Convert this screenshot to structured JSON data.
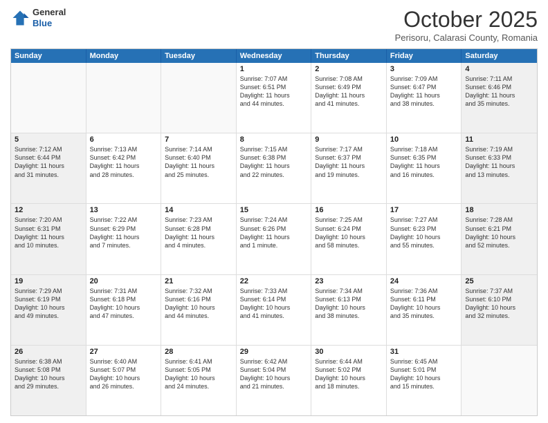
{
  "header": {
    "logo_general": "General",
    "logo_blue": "Blue",
    "month_title": "October 2025",
    "subtitle": "Perisoru, Calarasi County, Romania"
  },
  "weekdays": [
    "Sunday",
    "Monday",
    "Tuesday",
    "Wednesday",
    "Thursday",
    "Friday",
    "Saturday"
  ],
  "rows": [
    [
      {
        "day": "",
        "text": "",
        "empty": true
      },
      {
        "day": "",
        "text": "",
        "empty": true
      },
      {
        "day": "",
        "text": "",
        "empty": true
      },
      {
        "day": "1",
        "text": "Sunrise: 7:07 AM\nSunset: 6:51 PM\nDaylight: 11 hours\nand 44 minutes.",
        "empty": false
      },
      {
        "day": "2",
        "text": "Sunrise: 7:08 AM\nSunset: 6:49 PM\nDaylight: 11 hours\nand 41 minutes.",
        "empty": false
      },
      {
        "day": "3",
        "text": "Sunrise: 7:09 AM\nSunset: 6:47 PM\nDaylight: 11 hours\nand 38 minutes.",
        "empty": false
      },
      {
        "day": "4",
        "text": "Sunrise: 7:11 AM\nSunset: 6:46 PM\nDaylight: 11 hours\nand 35 minutes.",
        "empty": false,
        "shaded": true
      }
    ],
    [
      {
        "day": "5",
        "text": "Sunrise: 7:12 AM\nSunset: 6:44 PM\nDaylight: 11 hours\nand 31 minutes.",
        "empty": false,
        "shaded": true
      },
      {
        "day": "6",
        "text": "Sunrise: 7:13 AM\nSunset: 6:42 PM\nDaylight: 11 hours\nand 28 minutes.",
        "empty": false
      },
      {
        "day": "7",
        "text": "Sunrise: 7:14 AM\nSunset: 6:40 PM\nDaylight: 11 hours\nand 25 minutes.",
        "empty": false
      },
      {
        "day": "8",
        "text": "Sunrise: 7:15 AM\nSunset: 6:38 PM\nDaylight: 11 hours\nand 22 minutes.",
        "empty": false
      },
      {
        "day": "9",
        "text": "Sunrise: 7:17 AM\nSunset: 6:37 PM\nDaylight: 11 hours\nand 19 minutes.",
        "empty": false
      },
      {
        "day": "10",
        "text": "Sunrise: 7:18 AM\nSunset: 6:35 PM\nDaylight: 11 hours\nand 16 minutes.",
        "empty": false
      },
      {
        "day": "11",
        "text": "Sunrise: 7:19 AM\nSunset: 6:33 PM\nDaylight: 11 hours\nand 13 minutes.",
        "empty": false,
        "shaded": true
      }
    ],
    [
      {
        "day": "12",
        "text": "Sunrise: 7:20 AM\nSunset: 6:31 PM\nDaylight: 11 hours\nand 10 minutes.",
        "empty": false,
        "shaded": true
      },
      {
        "day": "13",
        "text": "Sunrise: 7:22 AM\nSunset: 6:29 PM\nDaylight: 11 hours\nand 7 minutes.",
        "empty": false
      },
      {
        "day": "14",
        "text": "Sunrise: 7:23 AM\nSunset: 6:28 PM\nDaylight: 11 hours\nand 4 minutes.",
        "empty": false
      },
      {
        "day": "15",
        "text": "Sunrise: 7:24 AM\nSunset: 6:26 PM\nDaylight: 11 hours\nand 1 minute.",
        "empty": false
      },
      {
        "day": "16",
        "text": "Sunrise: 7:25 AM\nSunset: 6:24 PM\nDaylight: 10 hours\nand 58 minutes.",
        "empty": false
      },
      {
        "day": "17",
        "text": "Sunrise: 7:27 AM\nSunset: 6:23 PM\nDaylight: 10 hours\nand 55 minutes.",
        "empty": false
      },
      {
        "day": "18",
        "text": "Sunrise: 7:28 AM\nSunset: 6:21 PM\nDaylight: 10 hours\nand 52 minutes.",
        "empty": false,
        "shaded": true
      }
    ],
    [
      {
        "day": "19",
        "text": "Sunrise: 7:29 AM\nSunset: 6:19 PM\nDaylight: 10 hours\nand 49 minutes.",
        "empty": false,
        "shaded": true
      },
      {
        "day": "20",
        "text": "Sunrise: 7:31 AM\nSunset: 6:18 PM\nDaylight: 10 hours\nand 47 minutes.",
        "empty": false
      },
      {
        "day": "21",
        "text": "Sunrise: 7:32 AM\nSunset: 6:16 PM\nDaylight: 10 hours\nand 44 minutes.",
        "empty": false
      },
      {
        "day": "22",
        "text": "Sunrise: 7:33 AM\nSunset: 6:14 PM\nDaylight: 10 hours\nand 41 minutes.",
        "empty": false
      },
      {
        "day": "23",
        "text": "Sunrise: 7:34 AM\nSunset: 6:13 PM\nDaylight: 10 hours\nand 38 minutes.",
        "empty": false
      },
      {
        "day": "24",
        "text": "Sunrise: 7:36 AM\nSunset: 6:11 PM\nDaylight: 10 hours\nand 35 minutes.",
        "empty": false
      },
      {
        "day": "25",
        "text": "Sunrise: 7:37 AM\nSunset: 6:10 PM\nDaylight: 10 hours\nand 32 minutes.",
        "empty": false,
        "shaded": true
      }
    ],
    [
      {
        "day": "26",
        "text": "Sunrise: 6:38 AM\nSunset: 5:08 PM\nDaylight: 10 hours\nand 29 minutes.",
        "empty": false,
        "shaded": true
      },
      {
        "day": "27",
        "text": "Sunrise: 6:40 AM\nSunset: 5:07 PM\nDaylight: 10 hours\nand 26 minutes.",
        "empty": false
      },
      {
        "day": "28",
        "text": "Sunrise: 6:41 AM\nSunset: 5:05 PM\nDaylight: 10 hours\nand 24 minutes.",
        "empty": false
      },
      {
        "day": "29",
        "text": "Sunrise: 6:42 AM\nSunset: 5:04 PM\nDaylight: 10 hours\nand 21 minutes.",
        "empty": false
      },
      {
        "day": "30",
        "text": "Sunrise: 6:44 AM\nSunset: 5:02 PM\nDaylight: 10 hours\nand 18 minutes.",
        "empty": false
      },
      {
        "day": "31",
        "text": "Sunrise: 6:45 AM\nSunset: 5:01 PM\nDaylight: 10 hours\nand 15 minutes.",
        "empty": false
      },
      {
        "day": "",
        "text": "",
        "empty": true,
        "shaded": true
      }
    ]
  ]
}
